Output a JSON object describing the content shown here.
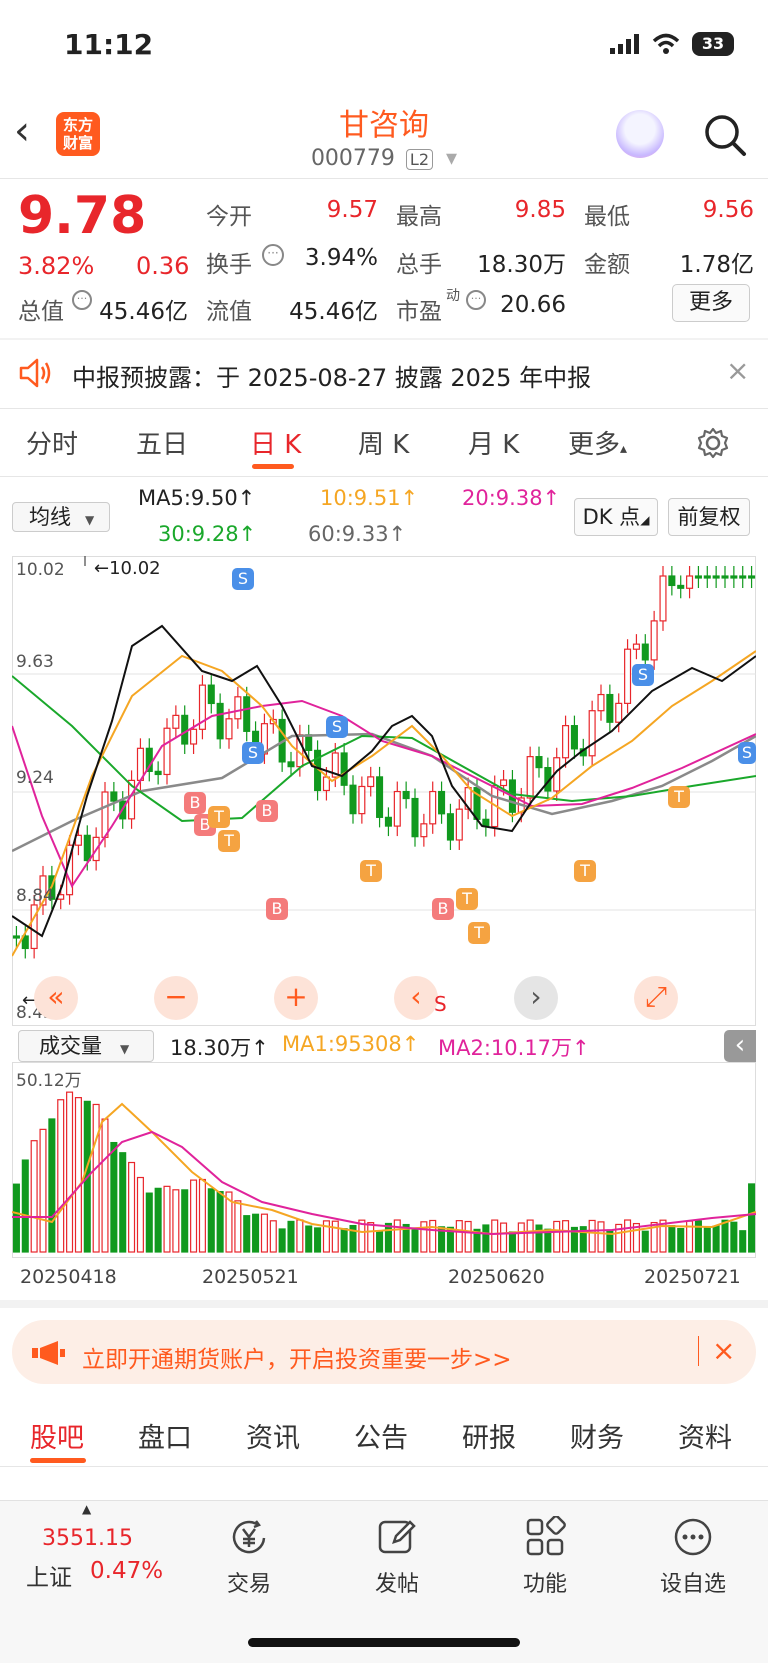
{
  "status_bar": {
    "time": "11:12",
    "battery": "33"
  },
  "nav": {
    "back": "‹",
    "logo": [
      "东方",
      "财富"
    ],
    "name": "甘咨询",
    "code": "000779",
    "badge": "L2",
    "dropdown": "▾"
  },
  "quote": {
    "price": "9.78",
    "change_pct": "3.82%",
    "change": "0.36",
    "rows": [
      [
        {
          "label": "今开",
          "value": "9.57",
          "red": true
        },
        {
          "label": "最高",
          "value": "9.85",
          "red": true
        },
        {
          "label": "最低",
          "value": "9.56",
          "red": true
        }
      ],
      [
        {
          "label": "换手",
          "value": "3.94%",
          "red": false
        },
        {
          "label": "总手",
          "value": "18.30万",
          "red": false
        },
        {
          "label": "金额",
          "value": "1.78亿",
          "red": false
        }
      ],
      [
        {
          "label": "总值",
          "value": "45.46亿",
          "red": false
        },
        {
          "label": "流值",
          "value": "45.46亿",
          "red": false
        },
        {
          "label": "市盈",
          "value": "20.66",
          "red": false
        }
      ]
    ],
    "pe_superscript": "动",
    "more": "更多"
  },
  "notice": {
    "text": "中报预披露：于 2025-08-27 披露 2025 年中报",
    "close": "×"
  },
  "period_tabs": [
    "分时",
    "五日",
    "日 K",
    "周 K",
    "月 K",
    "更多"
  ],
  "active_period": "日 K",
  "ma_legend": {
    "selector": "均线",
    "items": [
      {
        "text": "MA5:9.50↑",
        "color": "#222222"
      },
      {
        "text": "10:9.51↑",
        "color": "#f5a623"
      },
      {
        "text": "20:9.38↑",
        "color": "#e0239b"
      },
      {
        "text": "30:9.28↑",
        "color": "#1aa82b"
      },
      {
        "text": "60:9.33↑",
        "color": "#666666"
      }
    ],
    "dk": "DK 点",
    "fq": "前复权"
  },
  "kline": {
    "y_labels": [
      "10.02",
      "9.63",
      "9.24",
      "8.84",
      "8.45"
    ],
    "high_marker": "←10.02",
    "low_marker": "←8.45",
    "signal_s": "S",
    "signal_b": "B",
    "signal_t": "T",
    "bottom_s": "S"
  },
  "controls": {
    "minus": "−",
    "plus": "+",
    "left": "‹",
    "right": "›"
  },
  "volume": {
    "selector": "成交量",
    "value": "18.30万↑",
    "ma1": "MA1:95308↑",
    "ma2": "MA2:10.17万↑",
    "top_label": "50.12万",
    "collapse": "‹"
  },
  "dates": [
    "20250418",
    "20250521",
    "20250620",
    "20250721"
  ],
  "banner": {
    "text": "立即开通期货账户，开启投资重要一步>>",
    "close": "×"
  },
  "bottom_tabs": [
    "股吧",
    "盘口",
    "资讯",
    "公告",
    "研报",
    "财务",
    "资料"
  ],
  "footer": {
    "index_value": "3551.15",
    "index_name": "上证",
    "index_change": "0.47%",
    "items": [
      "交易",
      "发帖",
      "功能",
      "设自选"
    ]
  },
  "colors": {
    "up": "#e8262b",
    "down": "#11991e",
    "accent": "#ff5a1f"
  }
}
